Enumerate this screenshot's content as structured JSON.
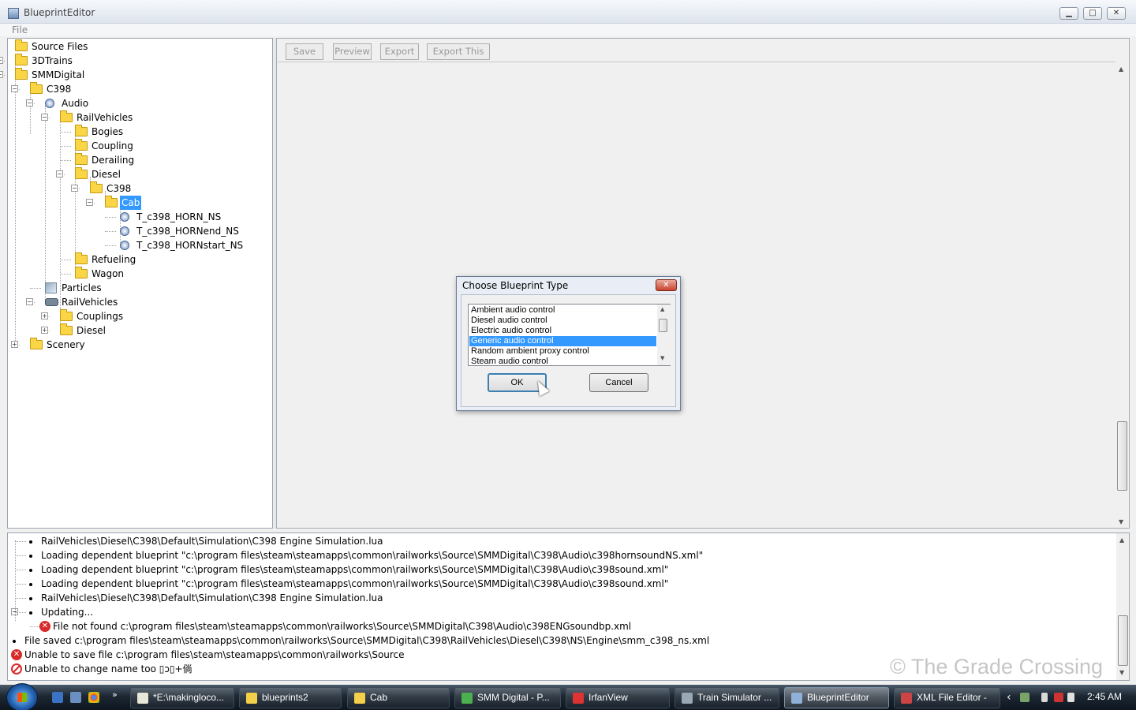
{
  "window": {
    "title": "BlueprintEditor",
    "min": "▁",
    "max": "□",
    "close": "✕"
  },
  "menu": {
    "file": "File"
  },
  "toolbar": {
    "save": "Save",
    "preview": "Preview",
    "export": "Export",
    "export_this": "Export This"
  },
  "tree": [
    {
      "label": "Source Files",
      "icon": "folder-icon"
    },
    {
      "label": "3DTrains",
      "icon": "folder-icon",
      "expander": "+"
    },
    {
      "label": "SMMDigital",
      "icon": "folder-icon",
      "expander": "-"
    },
    {
      "label": "C398",
      "icon": "folder-icon",
      "expander": "-"
    },
    {
      "label": "Audio",
      "icon": "audio-icon",
      "expander": "-"
    },
    {
      "label": "RailVehicles",
      "icon": "folder-icon",
      "expander": "-"
    },
    {
      "label": "Bogies",
      "icon": "folder-icon"
    },
    {
      "label": "Coupling",
      "icon": "folder-icon"
    },
    {
      "label": "Derailing",
      "icon": "folder-icon"
    },
    {
      "label": "Diesel",
      "icon": "folder-icon",
      "expander": "-"
    },
    {
      "label": "C398",
      "icon": "folder-icon",
      "expander": "-"
    },
    {
      "label": "Cab",
      "icon": "folder-icon",
      "expander": "-",
      "selected": true
    },
    {
      "label": "T_c398_HORN_NS",
      "icon": "audio-icon"
    },
    {
      "label": "T_c398_HORNend_NS",
      "icon": "audio-icon"
    },
    {
      "label": "T_c398_HORNstart_NS",
      "icon": "audio-icon"
    },
    {
      "label": "Refueling",
      "icon": "folder-icon"
    },
    {
      "label": "Wagon",
      "icon": "folder-icon"
    },
    {
      "label": "Particles",
      "icon": "particles-icon"
    },
    {
      "label": "RailVehicles",
      "icon": "railvehicle-icon",
      "expander": "-"
    },
    {
      "label": "Couplings",
      "icon": "folder-icon",
      "expander": "+"
    },
    {
      "label": "Diesel",
      "icon": "folder-icon",
      "expander": "+"
    },
    {
      "label": "Scenery",
      "icon": "folder-icon",
      "expander": "+"
    }
  ],
  "dialog": {
    "title": "Choose Blueprint Type",
    "close": "✕",
    "options": [
      "Ambient audio control",
      "Diesel audio control",
      "Electric audio control",
      "Generic audio control",
      "Random ambient proxy control",
      "Steam audio control"
    ],
    "selected": "Generic audio control",
    "ok": "OK",
    "cancel": "Cancel"
  },
  "log": [
    {
      "text": "RailVehicles\\Diesel\\C398\\Default\\Simulation\\C398 Engine Simulation.lua",
      "type": "bullet"
    },
    {
      "text": "Loading dependent blueprint \"c:\\program files\\steam\\steamapps\\common\\railworks\\Source\\SMMDigital\\C398\\Audio\\c398hornsoundNS.xml\"",
      "type": "bullet"
    },
    {
      "text": "Loading dependent blueprint \"c:\\program files\\steam\\steamapps\\common\\railworks\\Source\\SMMDigital\\C398\\Audio\\c398sound.xml\"",
      "type": "bullet"
    },
    {
      "text": "Loading dependent blueprint \"c:\\program files\\steam\\steamapps\\common\\railworks\\Source\\SMMDigital\\C398\\Audio\\c398sound.xml\"",
      "type": "bullet"
    },
    {
      "text": "RailVehicles\\Diesel\\C398\\Default\\Simulation\\C398 Engine Simulation.lua",
      "type": "bullet"
    },
    {
      "text": "Updating...",
      "type": "bullet"
    },
    {
      "text": "File not found c:\\program files\\steam\\steamapps\\common\\railworks\\Source\\SMMDigital\\C398\\Audio\\c398ENGsoundbp.xml",
      "type": "error"
    },
    {
      "text": "File saved c:\\program files\\steam\\steamapps\\common\\railworks\\Source\\SMMDigital\\C398\\RailVehicles\\Diesel\\C398\\NS\\Engine\\smm_c398_ns.xml",
      "type": "bullet"
    },
    {
      "text": "Unable to save file c:\\program files\\steam\\steamapps\\common\\railworks\\Source",
      "type": "error"
    },
    {
      "text": "Unable to change name toօ ▯ɔ▯+倘",
      "type": "forbidden"
    }
  ],
  "watermark": "© The Grade Crossing",
  "taskbar": {
    "tasks": [
      {
        "label": "*E:\\makingloco...",
        "icon": "notepad-icon",
        "color": "#e8e8d8"
      },
      {
        "label": "blueprints2",
        "icon": "folder-icon",
        "color": "#f3cf4a"
      },
      {
        "label": "Cab",
        "icon": "folder-icon",
        "color": "#f3cf4a"
      },
      {
        "label": "SMM Digital - P...",
        "icon": "chrome-icon",
        "color": "#4caf50"
      },
      {
        "label": "IrfanView",
        "icon": "irfanview-icon",
        "color": "#d33"
      },
      {
        "label": "Train Simulator ...",
        "icon": "steam-icon",
        "color": "#9aa7b4"
      },
      {
        "label": "BlueprintEditor",
        "icon": "blueprint-icon",
        "color": "#8fb0d8",
        "active": true
      },
      {
        "label": "XML File Editor -",
        "icon": "xml-icon",
        "color": "#c44"
      }
    ],
    "overflow": "»",
    "tray_arrow": "‹",
    "clock": "2:45 AM"
  }
}
